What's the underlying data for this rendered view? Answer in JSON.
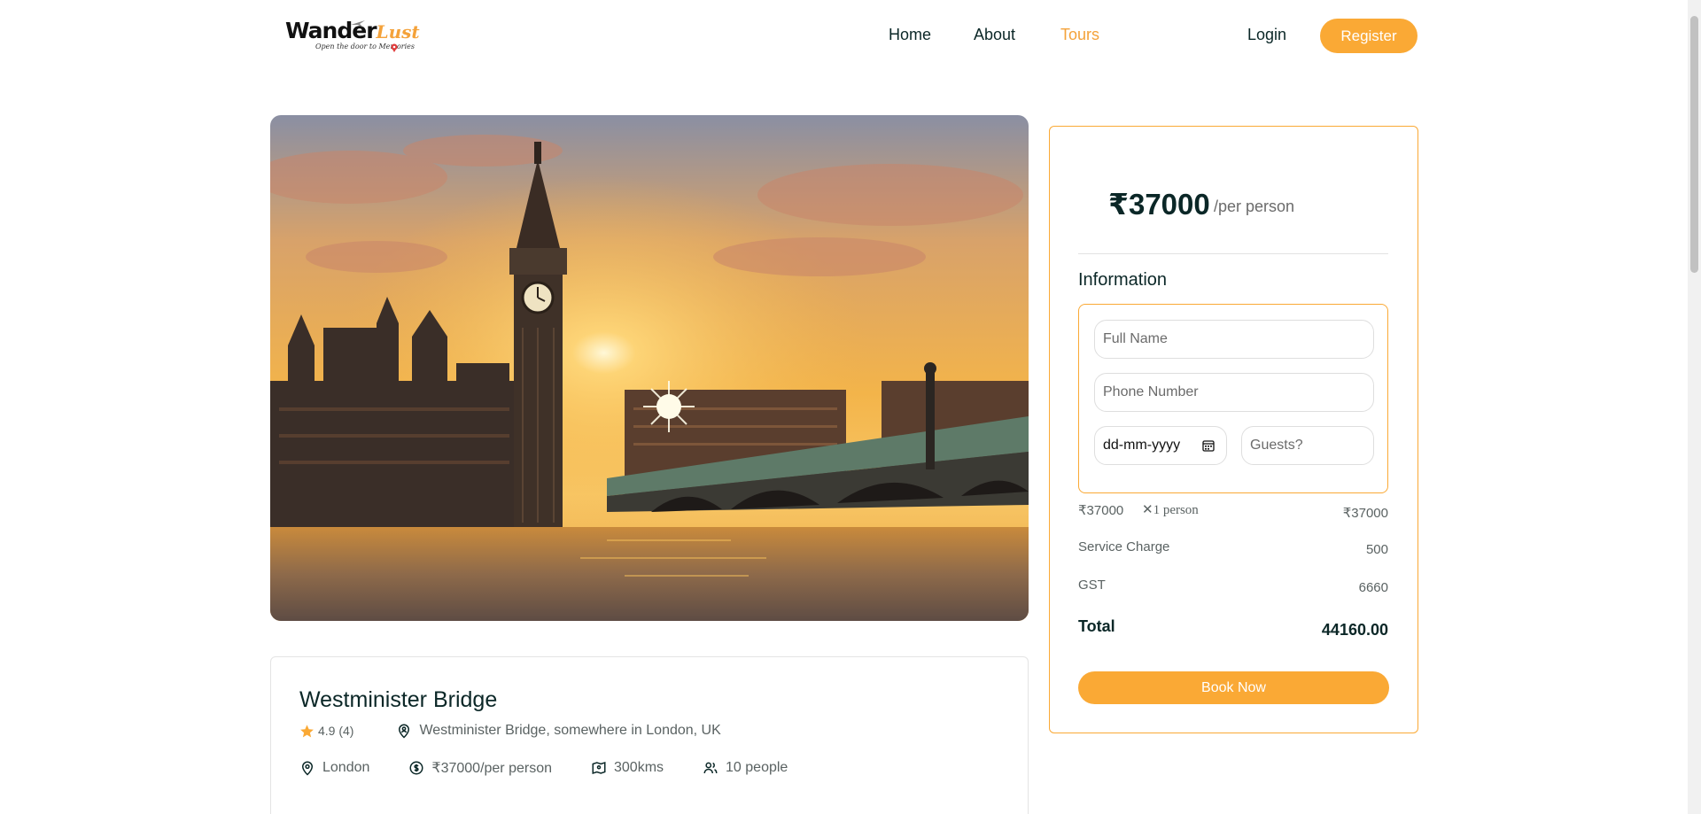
{
  "brand": {
    "name_part1": "Wander",
    "name_part2": "Lust",
    "tagline": "Open the door to Memories"
  },
  "nav": {
    "home": "Home",
    "about": "About",
    "tours": "Tours",
    "login": "Login",
    "register": "Register",
    "active": "Tours"
  },
  "colors": {
    "accent": "#faa935",
    "heading": "#0b2727",
    "muted": "#5a6262"
  },
  "tour": {
    "image_alt": "Big Ben and Westminster Bridge at sunset",
    "title": "Westminister Bridge",
    "rating": "4.9 (4)",
    "address": "Westminister Bridge, somewhere in London, UK",
    "city": "London",
    "price_per_person": "₹37000/per person",
    "distance": "300kms",
    "max_group": "10 people"
  },
  "booking": {
    "price": "₹37000",
    "per_person": "/per person",
    "info_heading": "Information",
    "full_name_placeholder": "Full Name",
    "phone_placeholder": "Phone Number",
    "date_placeholder": "dd-mm-yyyy",
    "guests_placeholder": "Guests?",
    "calc_base": "₹37000",
    "calc_mult": "✕1 person",
    "calc_base_total": "₹37000",
    "service_label": "Service Charge",
    "service_value": "500",
    "gst_label": "GST",
    "gst_value": "6660",
    "total_label": "Total",
    "total_value": "44160.00",
    "book_button": "Book Now"
  },
  "icons": {
    "star": "star-icon",
    "address": "map-pin-user-icon",
    "city": "map-pin-icon",
    "price": "money-dollar-icon",
    "distance": "map-pin-time-icon",
    "group": "group-icon",
    "calendar": "calendar-icon"
  }
}
